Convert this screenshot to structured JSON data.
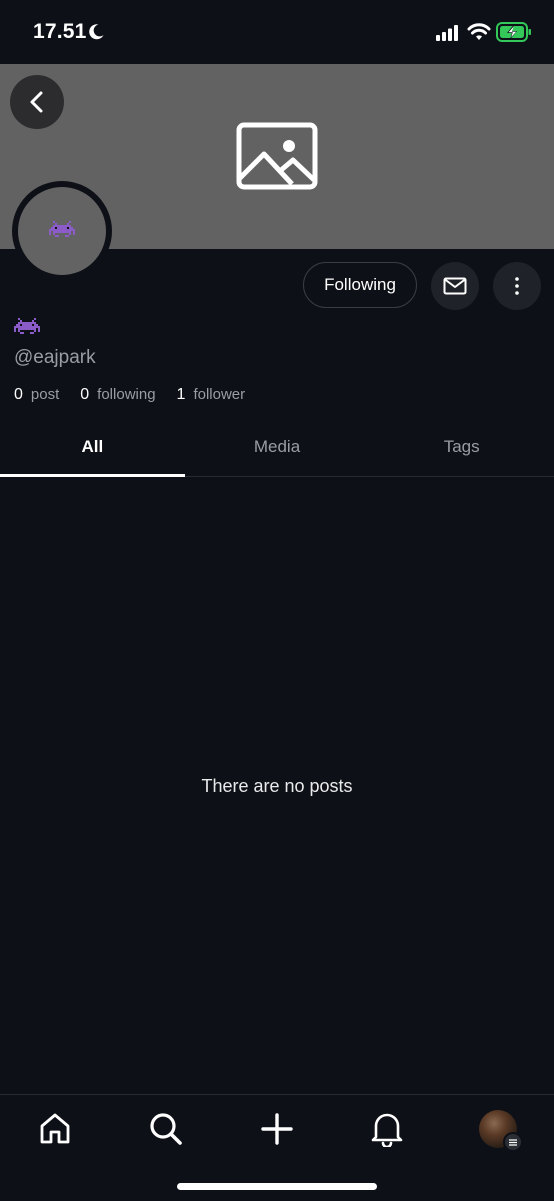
{
  "status_bar": {
    "time": "17.51",
    "icons": [
      "moon-icon",
      "signal-icon",
      "wifi-icon",
      "battery-charging-icon"
    ],
    "battery_color": "#34c759"
  },
  "banner": {
    "background_color": "#626262",
    "placeholder_icon": "image-placeholder-icon"
  },
  "profile": {
    "avatar_emoji": "👾",
    "display_name": "👾",
    "handle": "@eajpark",
    "stats": {
      "posts_count": "0",
      "posts_label": "post",
      "following_count": "0",
      "following_label": "following",
      "followers_count": "1",
      "followers_label": "follower"
    }
  },
  "actions": {
    "following_label": "Following",
    "message_icon": "envelope-icon",
    "more_icon": "more-vertical-icon"
  },
  "tabs": [
    {
      "label": "All",
      "active": true
    },
    {
      "label": "Media",
      "active": false
    },
    {
      "label": "Tags",
      "active": false
    }
  ],
  "feed": {
    "empty_message": "There are no posts"
  },
  "bottom_nav": {
    "items": [
      "home-icon",
      "search-icon",
      "plus-icon",
      "bell-icon",
      "profile-avatar"
    ]
  },
  "colors": {
    "background": "#0d1016",
    "muted_text": "#9a9da3",
    "button_bg": "#1f2228"
  }
}
